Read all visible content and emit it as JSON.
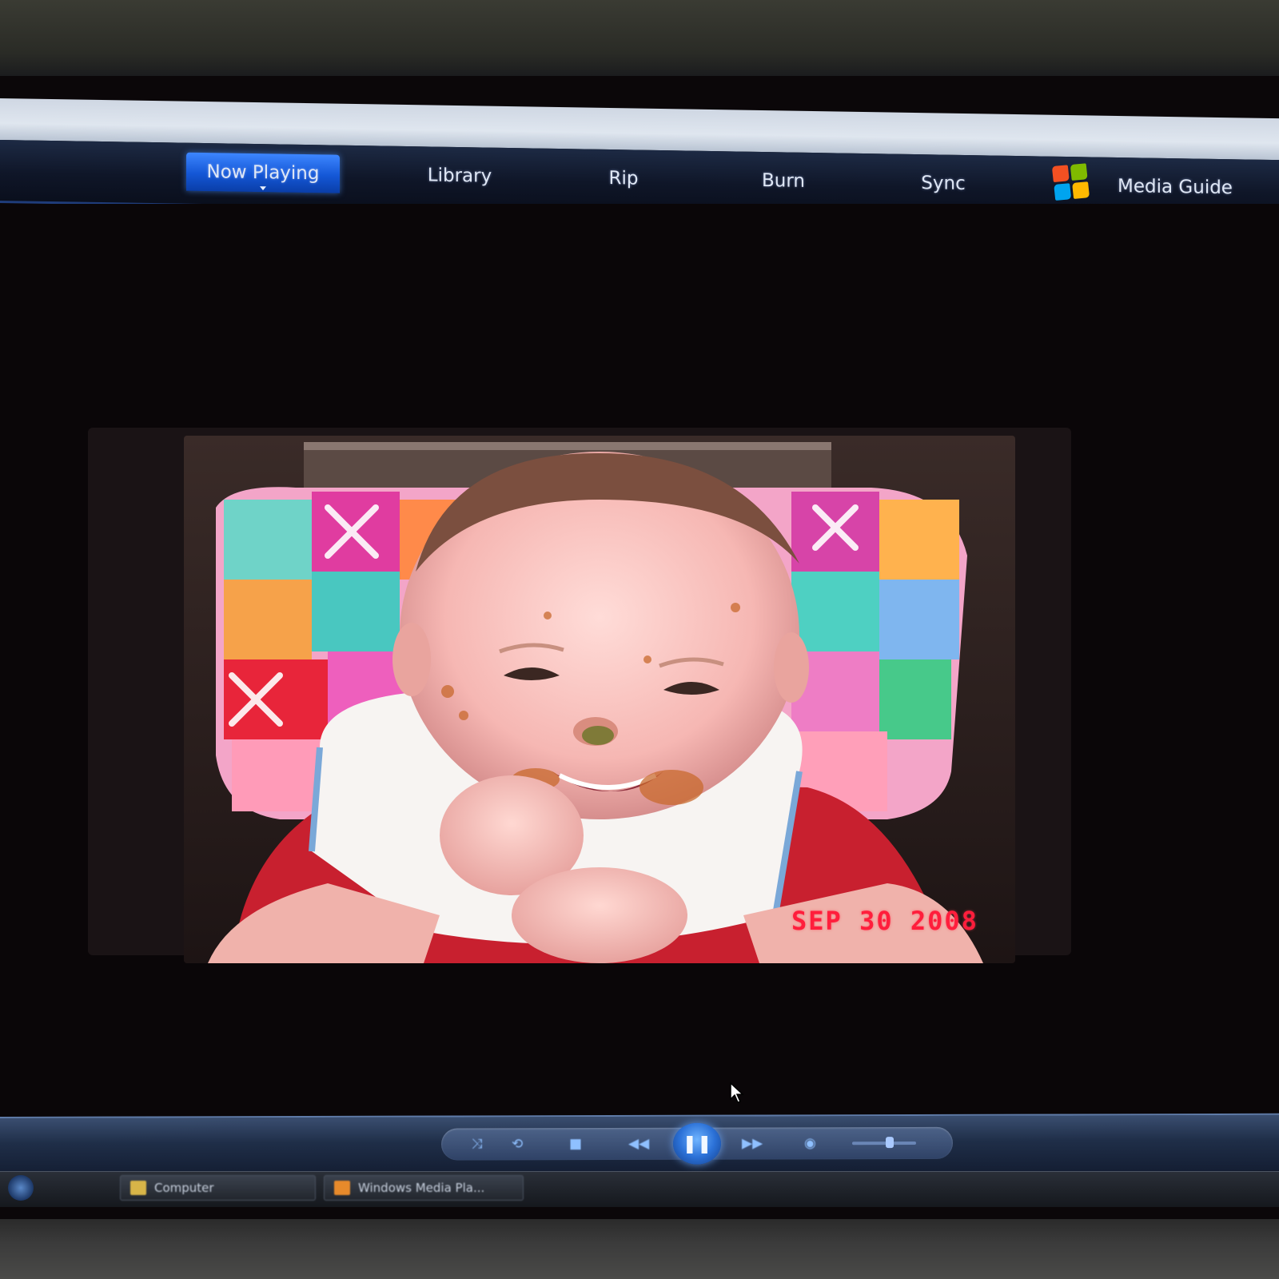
{
  "nav": {
    "tabs": [
      {
        "label": "Now Playing",
        "active": true
      },
      {
        "label": "Library",
        "active": false
      },
      {
        "label": "Rip",
        "active": false
      },
      {
        "label": "Burn",
        "active": false
      },
      {
        "label": "Sync",
        "active": false
      }
    ],
    "media_guide": "Media Guide"
  },
  "photo": {
    "date_stamp": "SEP 30 2008"
  },
  "controls": {
    "status_text": "",
    "time_text": "",
    "buttons": {
      "shuffle": "⤨",
      "repeat": "⟲",
      "stop": "■",
      "previous": "◀◀",
      "play_pause": "❚❚",
      "next": "▶▶",
      "mute": "◉"
    }
  },
  "taskbar": {
    "items": [
      {
        "label": "Computer"
      },
      {
        "label": "Windows Media Pla..."
      }
    ]
  },
  "colors": {
    "active_tab": "#1457d6",
    "date_stamp": "#ff1e3c",
    "nav_bg": "#0f1628"
  }
}
